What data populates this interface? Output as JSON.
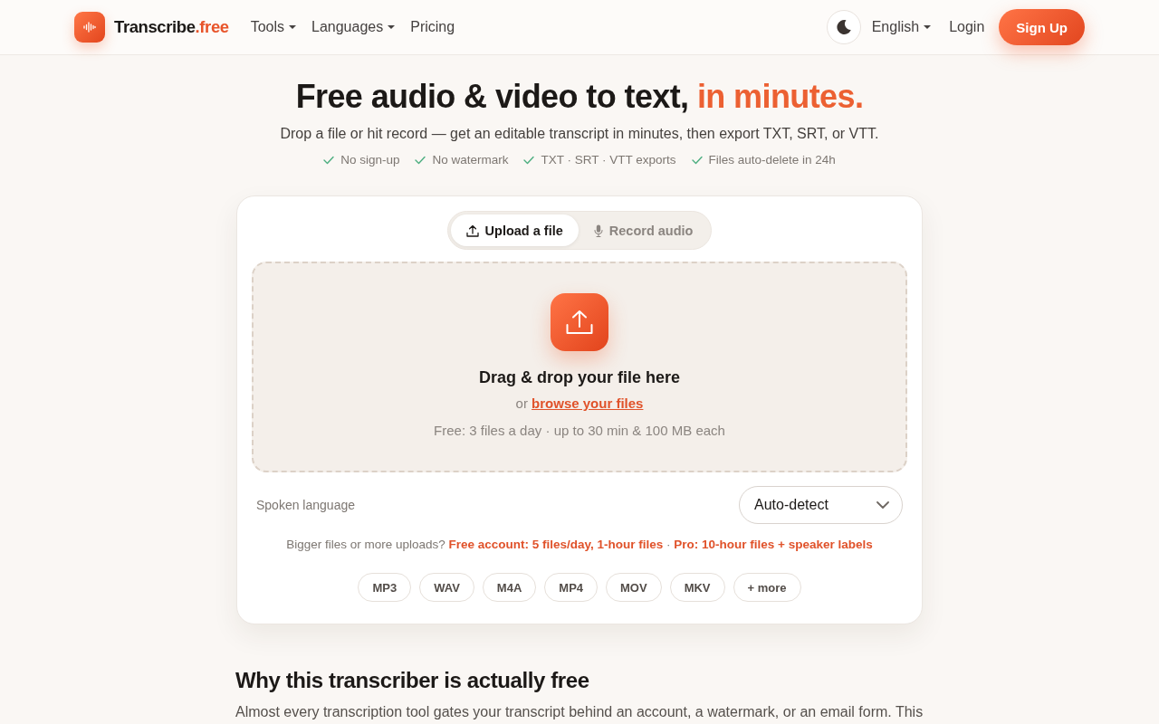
{
  "nav": {
    "brand": {
      "text": "Transcribe",
      "accent": ".free"
    },
    "menu": [
      {
        "label": "Tools",
        "kind": "dropdown"
      },
      {
        "label": "Languages",
        "kind": "dropdown"
      },
      {
        "label": "Pricing",
        "kind": "link"
      }
    ],
    "right_menu": [
      {
        "label": "English",
        "kind": "dropdown"
      },
      {
        "label": "Login",
        "kind": "link"
      }
    ],
    "signup_button": "Sign Up"
  },
  "hero": {
    "title": "Free audio & video to text,",
    "title_accent": "in minutes.",
    "subtitle": "Drop a file or hit record — get an editable transcript in minutes, then export TXT, SRT, or VTT.",
    "features": [
      "No sign-up",
      "No watermark",
      "TXT · SRT · VTT exports",
      "Files auto-delete in 24h"
    ]
  },
  "card": {
    "tabs": [
      {
        "label": "Upload a file",
        "kind": "upload",
        "selected": true
      },
      {
        "label": "Record audio",
        "kind": "record",
        "selected": false
      }
    ],
    "dropzone": {
      "title": "Drag & drop your file here",
      "prefix": "or",
      "link": "browse your files",
      "limits": "Free: 3 files a day · up to 30 min & 100 MB each"
    },
    "language": {
      "label": "Spoken language",
      "value": "Auto-detect"
    },
    "upsell": {
      "text": "Bigger files or more uploads?",
      "links": [
        "Free account: 5 files/day, 1-hour files",
        "Pro: 10-hour files + speaker labels"
      ],
      "separator": "·"
    },
    "formats": [
      "MP3",
      "WAV",
      "M4A",
      "MP4",
      "MOV",
      "MKV",
      "+ more"
    ]
  },
  "section": {
    "title": "Why this transcriber is actually free",
    "body": "Almost every transcription tool gates your transcript behind an account, a watermark, or an email form. This"
  }
}
